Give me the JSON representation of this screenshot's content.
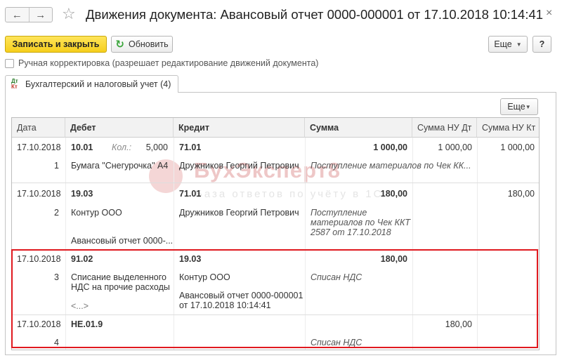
{
  "window": {
    "title": "Движения документа: Авансовый отчет 0000-000001 от 17.10.2018 10:14:41",
    "back_icon": "←",
    "forward_icon": "→",
    "favorite_icon": "☆",
    "close_icon": "×"
  },
  "toolbar": {
    "save_close_label": "Записать и закрыть",
    "refresh_label": "Обновить",
    "more_label": "Еще",
    "help_label": "?"
  },
  "manual_adjust": {
    "label": "Ручная корректировка (разрешает редактирование движений документа)",
    "checked": false
  },
  "tab": {
    "label": "Бухгалтерский и налоговый учет (4)",
    "icon_top": "Дт",
    "icon_bottom": "Кт"
  },
  "table_toolbar": {
    "more_label": "Еще"
  },
  "table": {
    "columns": [
      "Дата",
      "Дебет",
      "Кредит",
      "Сумма",
      "Сумма НУ Дт",
      "Сумма НУ Кт"
    ],
    "rows": [
      {
        "date": "17.10.2018",
        "num": "1",
        "debit_account": "10.01",
        "qty_label": "Кол.:",
        "qty_value": "5,000",
        "debit_sub1": "Бумага \"Снегурочка\" А4",
        "debit_sub2": "",
        "credit_account": "71.01",
        "credit_sub1": "Дружников Георгий Петрович",
        "credit_sub2": "",
        "amount": "1 000,00",
        "content": "Поступление материалов по Чек КК...",
        "nu_dt": "1 000,00",
        "nu_kt": "1 000,00"
      },
      {
        "date": "17.10.2018",
        "num": "2",
        "debit_account": "19.03",
        "debit_sub1": "Контур ООО",
        "debit_sub2": "Авансовый отчет 0000-...",
        "credit_account": "71.01",
        "credit_sub1": "Дружников Георгий Петрович",
        "amount": "180,00",
        "content_lines": [
          "Поступление",
          "материалов по Чек ККТ",
          "2587 от 17.10.2018"
        ],
        "nu_dt": "",
        "nu_kt": "180,00"
      },
      {
        "date": "17.10.2018",
        "num": "3",
        "debit_account": "91.02",
        "debit_sub1_lines": [
          "Списание выделенного",
          "НДС на прочие расходы"
        ],
        "debit_sub3": "<...>",
        "credit_account": "19.03",
        "credit_sub1": "Контур ООО",
        "credit_sub2_lines": [
          "Авансовый отчет 0000-000001",
          "от 17.10.2018 10:14:41"
        ],
        "amount": "180,00",
        "content": "Списан НДС",
        "nu_dt": "",
        "nu_kt": ""
      },
      {
        "date": "17.10.2018",
        "num": "4",
        "debit_account": "НЕ.01.9",
        "credit_account": "",
        "amount": "",
        "content": "Списан НДС",
        "nu_dt": "180,00",
        "nu_kt": ""
      }
    ]
  },
  "watermark": {
    "brand": "БухЭксперт8",
    "tagline": "База ответов по учёту в 1С"
  },
  "colors": {
    "save_button": "#f6cf1c",
    "highlight_border": "#e0191f",
    "header_bg": "#f2f2f2"
  }
}
